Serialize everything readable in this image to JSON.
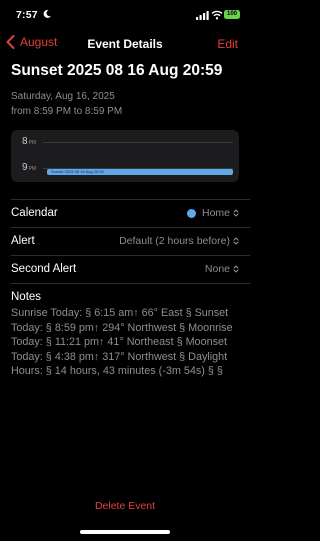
{
  "status_bar": {
    "time": "7:57",
    "battery": "100",
    "icons": [
      "moon-icon",
      "signal-icon",
      "wifi-icon",
      "battery-icon"
    ],
    "battery_color": "#6ad14c"
  },
  "nav": {
    "back_label": "August",
    "title": "Event Details",
    "edit_label": "Edit"
  },
  "event": {
    "title": "Sunset 2025 08 16 Aug 20:59",
    "date": "Saturday, Aug 16, 2025",
    "time_range": "from 8:59 PM to 8:59 PM"
  },
  "timeline": {
    "hour1": "8",
    "hour1_period": "PM",
    "hour2": "9",
    "hour2_period": "PM",
    "event_label": "Sunset 2025 08 16 Aug 20:59"
  },
  "details": {
    "calendar_label": "Calendar",
    "calendar_value": "Home",
    "calendar_color": "#5fa8ea",
    "alert_label": "Alert",
    "alert_value": "Default (2 hours before)",
    "second_alert_label": "Second Alert",
    "second_alert_value": "None"
  },
  "notes": {
    "label": "Notes",
    "text": "Sunrise Today: § 6:15 am↑ 66° East § Sunset Today: § 8:59 pm↑ 294° Northwest § Moonrise Today: § 11:21 pm↑ 41° Northeast § Moonset Today: § 4:38 pm↑ 317° Northwest § Daylight Hours: § 14 hours, 43 minutes (-3m 54s) § §"
  },
  "actions": {
    "delete_label": "Delete Event"
  },
  "colors": {
    "accent": "#e0413a",
    "background": "#000000",
    "secondary_text": "#8e8e93"
  }
}
